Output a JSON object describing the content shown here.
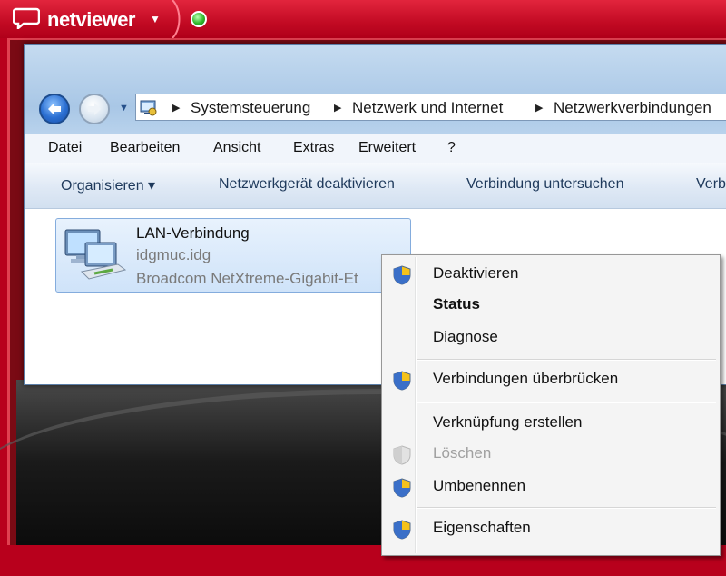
{
  "netviewer": {
    "title": "netviewer",
    "caret": "▼"
  },
  "address": {
    "crumbs": [
      "Systemsteuerung",
      "Netzwerk und Internet",
      "Netzwerkverbindungen"
    ]
  },
  "menu": [
    "Datei",
    "Bearbeiten",
    "Ansicht",
    "Extras",
    "Erweitert",
    "?"
  ],
  "toolbar": {
    "organize": "Organisieren ▾",
    "deactivate": "Netzwerkgerät deaktivieren",
    "diagnose": "Verbindung untersuchen",
    "cut": "Verb"
  },
  "connection": {
    "name": "LAN-Verbindung",
    "network": "idgmuc.idg",
    "device": "Broadcom NetXtreme-Gigabit-Et"
  },
  "context_menu": [
    {
      "label": "Deaktivieren",
      "shield": true
    },
    {
      "label": "Status",
      "bold": true
    },
    {
      "label": "Diagnose"
    },
    {
      "label": "Verbindungen überbrücken",
      "shield": true
    },
    {
      "label": "Verknüpfung erstellen"
    },
    {
      "label": "Löschen",
      "shield": true,
      "disabled": true
    },
    {
      "label": "Umbenennen",
      "shield": true
    },
    {
      "label": "Eigenschaften",
      "shield": true
    }
  ],
  "colors": {
    "netviewer_red": "#c20a23",
    "chrome_blue": "#a9c7e6",
    "selection_blue": "#cfe3f9"
  }
}
